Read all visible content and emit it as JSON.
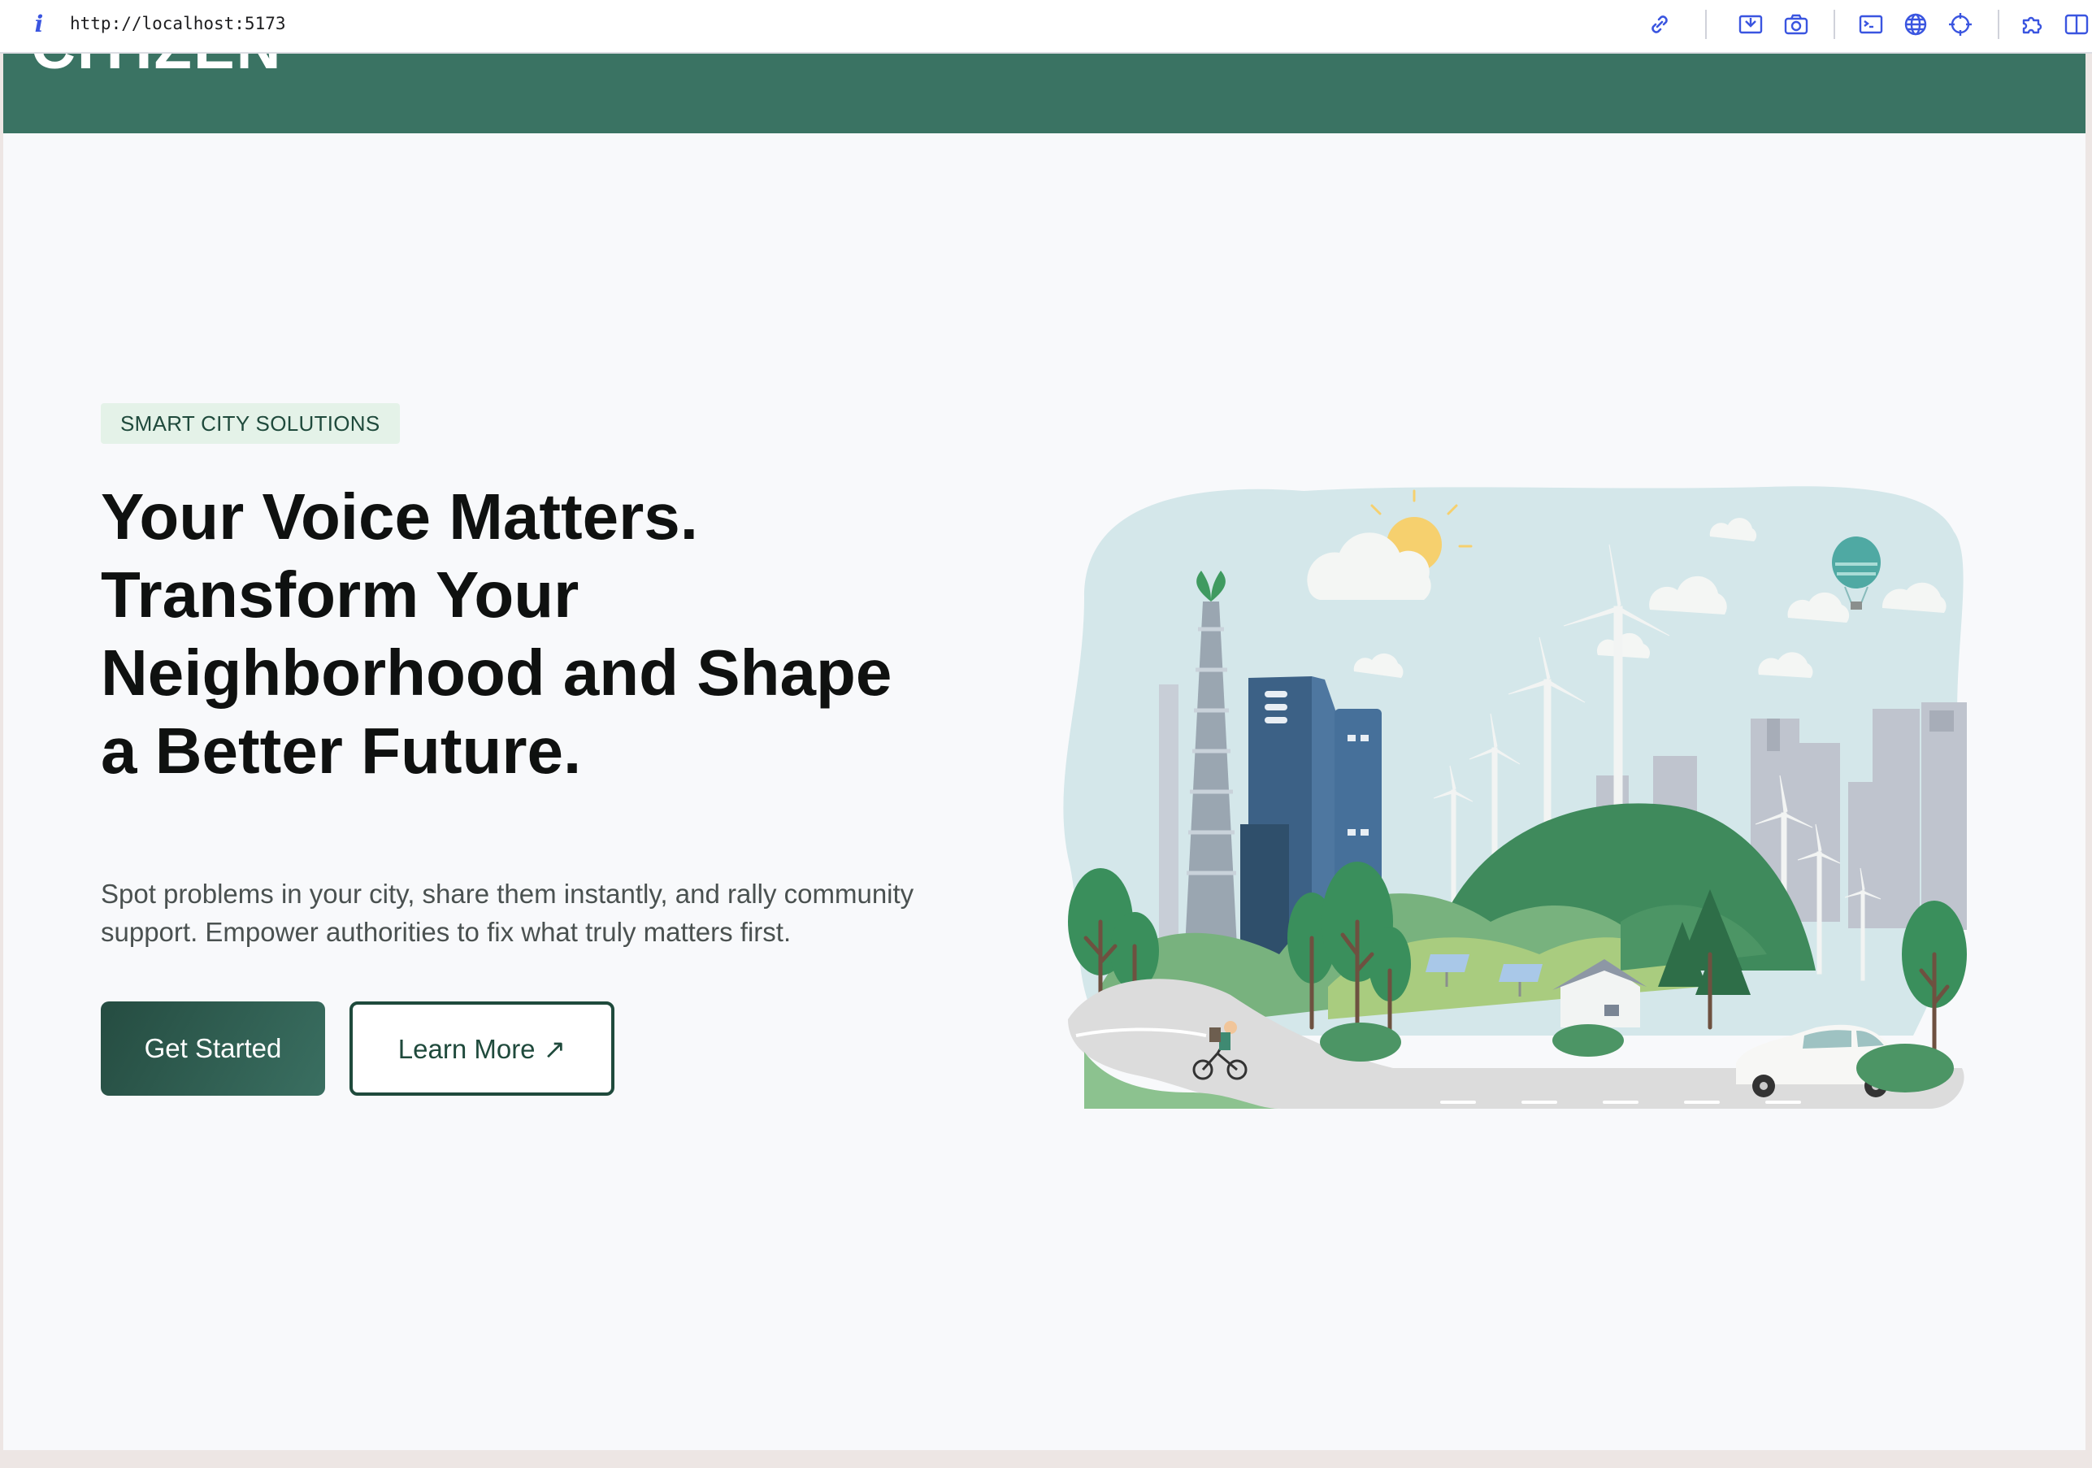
{
  "browser": {
    "url": "http://localhost:5173",
    "icons": [
      "info-icon",
      "link-icon",
      "screenshot-area-icon",
      "camera-icon",
      "terminal-icon",
      "globe-icon",
      "crosshair-icon",
      "extension-icon",
      "split-view-icon"
    ]
  },
  "header": {
    "brand": "CITIZEN",
    "bg_color": "#3a7363"
  },
  "hero": {
    "badge": "SMART CITY SOLUTIONS",
    "headline": "Your Voice Matters. Transform Your Neighborhood and Shape a Better Future.",
    "description": "Spot problems in your city, share them instantly, and rally community support. Empower authorities to fix what truly matters first.",
    "primary_button": "Get Started",
    "secondary_button": "Learn More",
    "secondary_icon": "↗"
  },
  "illustration": {
    "subject": "green smart city"
  },
  "colors": {
    "accent": "#1f4a3c",
    "badge_bg": "#e4f2e8"
  }
}
